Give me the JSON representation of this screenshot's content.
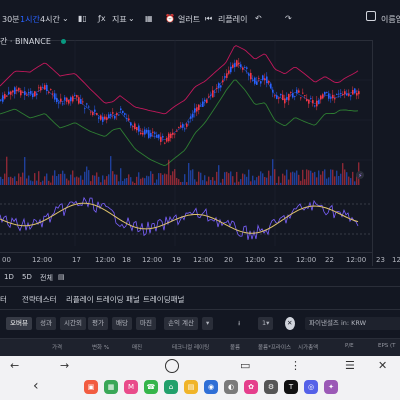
{
  "toolbar": {
    "interval_30m": "30분",
    "interval_1h": "1시간",
    "interval_4h": "4시간",
    "indicators_label": "지표",
    "alert_label": "얼러트",
    "replay_label": "리플레이",
    "username": "이름업"
  },
  "symbol": {
    "title": "간 · BINANCE"
  },
  "time_axis": [
    "00",
    "12:00",
    "17",
    "12:00",
    "18",
    "12:00",
    "19",
    "12:00",
    "20",
    "12:00",
    "21",
    "12:00",
    "22",
    "12:00",
    "23",
    "12"
  ],
  "range_bar": {
    "d1": "1D",
    "d5": "5D",
    "all": "전체"
  },
  "panel_tabs": {
    "t1": "터",
    "strategy_tester": "전략테스터",
    "replay_panel": "리플레이 트레이딩 패널",
    "trading_panel": "트레이딩패널"
  },
  "filters": {
    "overview": "오버뷰",
    "performance": "성과",
    "valuation": "시간외",
    "dividends": "평가",
    "margins": "배당",
    "profitability": "마진",
    "income": "손익 계산",
    "currency_label": "파이낸셜즈 in: KRW"
  },
  "columns": [
    "가격",
    "변화 %",
    "매진",
    "테크니컬 레이팅",
    "볼륨",
    "볼륨*프라이스",
    "시가총액",
    "P/E",
    "EPS (T"
  ],
  "system_nav": {
    "back": "←",
    "forward": "→",
    "home_back": "‹"
  },
  "colors": {
    "bg": "#131722",
    "up": "#f23645",
    "down": "#2962ff",
    "band_upper": "#c2185b",
    "band_lower": "#2e7d32",
    "osc_line": "#7b61ff",
    "osc_signal": "#e0c36b"
  }
}
